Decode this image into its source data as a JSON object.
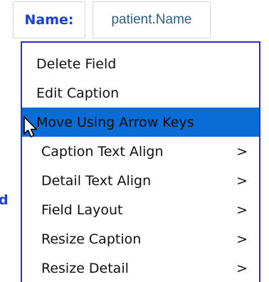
{
  "field": {
    "caption": "Name:",
    "detail": "patient.Name"
  },
  "background_label": "d",
  "context_menu": {
    "items": [
      {
        "label": "Delete Field",
        "has_submenu": false,
        "submenu_indicator": ""
      },
      {
        "label": "Edit Caption",
        "has_submenu": false,
        "submenu_indicator": ""
      },
      {
        "label": "Move Using Arrow Keys",
        "has_submenu": false,
        "submenu_indicator": "",
        "highlighted": true
      },
      {
        "label": "Caption Text Align",
        "has_submenu": true,
        "submenu_indicator": ">"
      },
      {
        "label": "Detail Text Align",
        "has_submenu": true,
        "submenu_indicator": ">"
      },
      {
        "label": "Field Layout",
        "has_submenu": true,
        "submenu_indicator": ">"
      },
      {
        "label": "Resize Caption",
        "has_submenu": true,
        "submenu_indicator": ">"
      },
      {
        "label": "Resize Detail",
        "has_submenu": true,
        "submenu_indicator": ">"
      }
    ]
  },
  "colors": {
    "caption_text": "#1a3fd6",
    "detail_text": "#2b5f86",
    "menu_border": "#2c2ccb",
    "highlight": "#0a6cd6"
  },
  "icons": {
    "cursor": "mouse-pointer-icon"
  }
}
